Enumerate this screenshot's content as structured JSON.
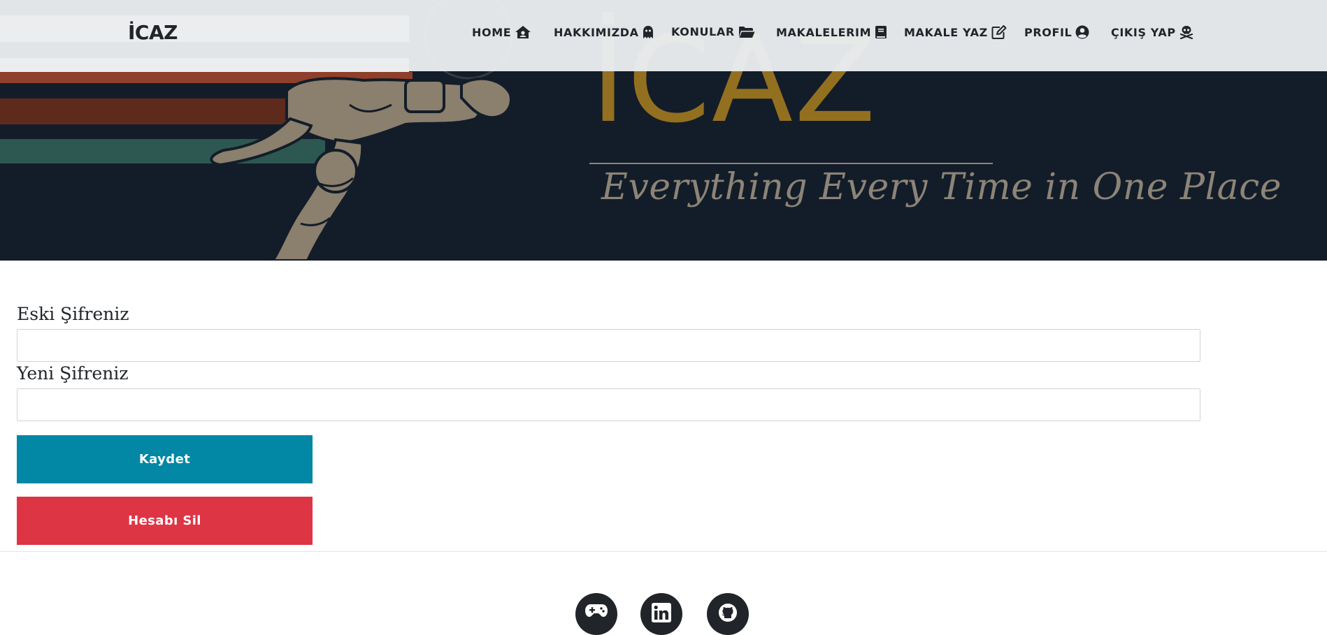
{
  "brand": {
    "logo": "İCAZ"
  },
  "hero": {
    "title": "İCAZ",
    "tagline": "Everything Every Time in One Place"
  },
  "nav": {
    "items": [
      {
        "label": "HOME",
        "icon": "house-user-icon"
      },
      {
        "label": "HAKKIMIZDA",
        "icon": "ghost-icon"
      },
      {
        "label": "KONULAR",
        "icon": "folder-open-icon"
      },
      {
        "label": "MAKALELERIM",
        "icon": "book-icon"
      },
      {
        "label": "MAKALE YAZ",
        "icon": "edit-icon"
      },
      {
        "label": "PROFIL",
        "icon": "user-circle-icon"
      },
      {
        "label": "ÇIKIŞ YAP",
        "icon": "skull-crossbones-icon"
      }
    ]
  },
  "form": {
    "old_password_label": "Eski Şifreniz",
    "old_password_value": "",
    "new_password_label": "Yeni Şifreniz",
    "new_password_value": "",
    "save_label": "Kaydet",
    "delete_label": "Hesabı Sil"
  },
  "footer": {
    "social": [
      {
        "icon": "gamepad-icon"
      },
      {
        "icon": "linkedin-icon"
      },
      {
        "icon": "github-icon"
      }
    ]
  },
  "colors": {
    "hero_bg": "#131d29",
    "accent_gold": "#93701f",
    "save_button": "#0287a4",
    "delete_button": "#de3545",
    "navbar_bg": "#eaecef"
  }
}
